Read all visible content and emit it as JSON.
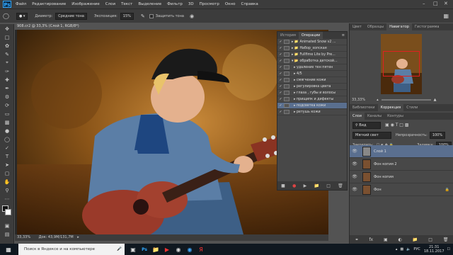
{
  "app": {
    "logo": "Ps"
  },
  "menu": [
    "Файл",
    "Редактирование",
    "Изображение",
    "Слои",
    "Текст",
    "Выделение",
    "Фильтр",
    "3D",
    "Просмотр",
    "Окно",
    "Справка"
  ],
  "options": {
    "diameter_label": "Диаметр:",
    "sample_value": "Средние тона",
    "exposure_label": "Экспозиция:",
    "exposure_value": "15%",
    "protect_label": "Защитить тона"
  },
  "document": {
    "tab": "908.cr2 @ 33,3% (Слой 1, RGB/8*)",
    "zoom": "33,33%",
    "doc_info": "Док: 43,9М/131,7М"
  },
  "history_panel": {
    "tabs": [
      "История",
      "Операции"
    ],
    "actions": [
      "Animated Snow v2 ...",
      "Набор_хопская",
      "Fullfime Lite by Pre...",
      "обработка детской...",
      "удаление тен пятен",
      "4/5",
      "смягчение кожи",
      "регулировка цвета",
      "глаза , губы и волосы",
      "прищипк и дифекты",
      "подсветка кожи",
      "ретушь кожи"
    ],
    "highlighted_index": 10
  },
  "right_panel": {
    "top_tabs": [
      "Цвет",
      "Образцы",
      "Навигатор",
      "Гистограмма"
    ],
    "nav_zoom": "33,33%",
    "mid_tabs": [
      "Библиотеки",
      "Коррекция",
      "Стили"
    ],
    "layer_tabs": [
      "Слои",
      "Каналы",
      "Контуры"
    ],
    "kind_label": "Вид",
    "blend_mode": "Мягкий свет",
    "opacity_label": "Непрозрачность:",
    "opacity_value": "100%",
    "lock_label": "Закрепить:",
    "fill_label": "Заливка:",
    "fill_value": "100%",
    "layers": [
      {
        "name": "Слой 1",
        "selected": true
      },
      {
        "name": "Фон копия 2",
        "selected": false
      },
      {
        "name": "Фон копия",
        "selected": false
      },
      {
        "name": "Фон",
        "selected": false
      }
    ]
  },
  "taskbar": {
    "search_placeholder": "Поиск в Яндексе и на компьютере",
    "lang": "РУС",
    "time": "21:31",
    "date": "18.11.2017"
  },
  "colors": {
    "ps_blue": "#31a8ff",
    "selection": "#5a6f8f"
  }
}
